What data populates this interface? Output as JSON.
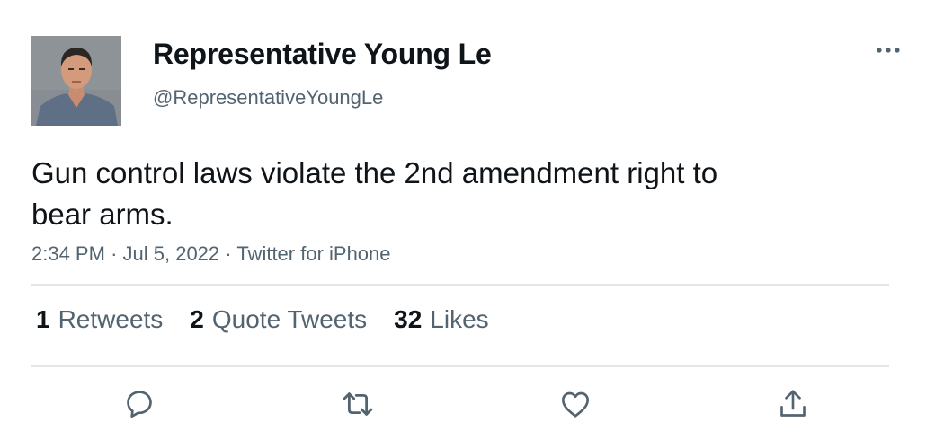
{
  "author": {
    "display_name": "Representative Young Le",
    "handle": "@RepresentativeYoungLe"
  },
  "tweet": {
    "text_lines": [
      "Gun control laws violate the 2nd amendment right to",
      "bear arms."
    ],
    "time": "2:34 PM",
    "date": "Jul 5, 2022",
    "source": "Twitter for iPhone",
    "separator": "·"
  },
  "stats": {
    "retweets": {
      "count": "1",
      "label": "Retweets"
    },
    "quote_tweets": {
      "count": "2",
      "label": "Quote Tweets"
    },
    "likes": {
      "count": "32",
      "label": "Likes"
    }
  },
  "icons": {
    "more": "more-horizontal-icon",
    "reply": "reply-bubble-icon",
    "retweet": "retweet-arrows-icon",
    "like": "heart-icon",
    "share": "share-upload-icon"
  },
  "colors": {
    "text_primary": "#0f1419",
    "text_secondary": "#536471",
    "divider": "#e3e6e8"
  }
}
